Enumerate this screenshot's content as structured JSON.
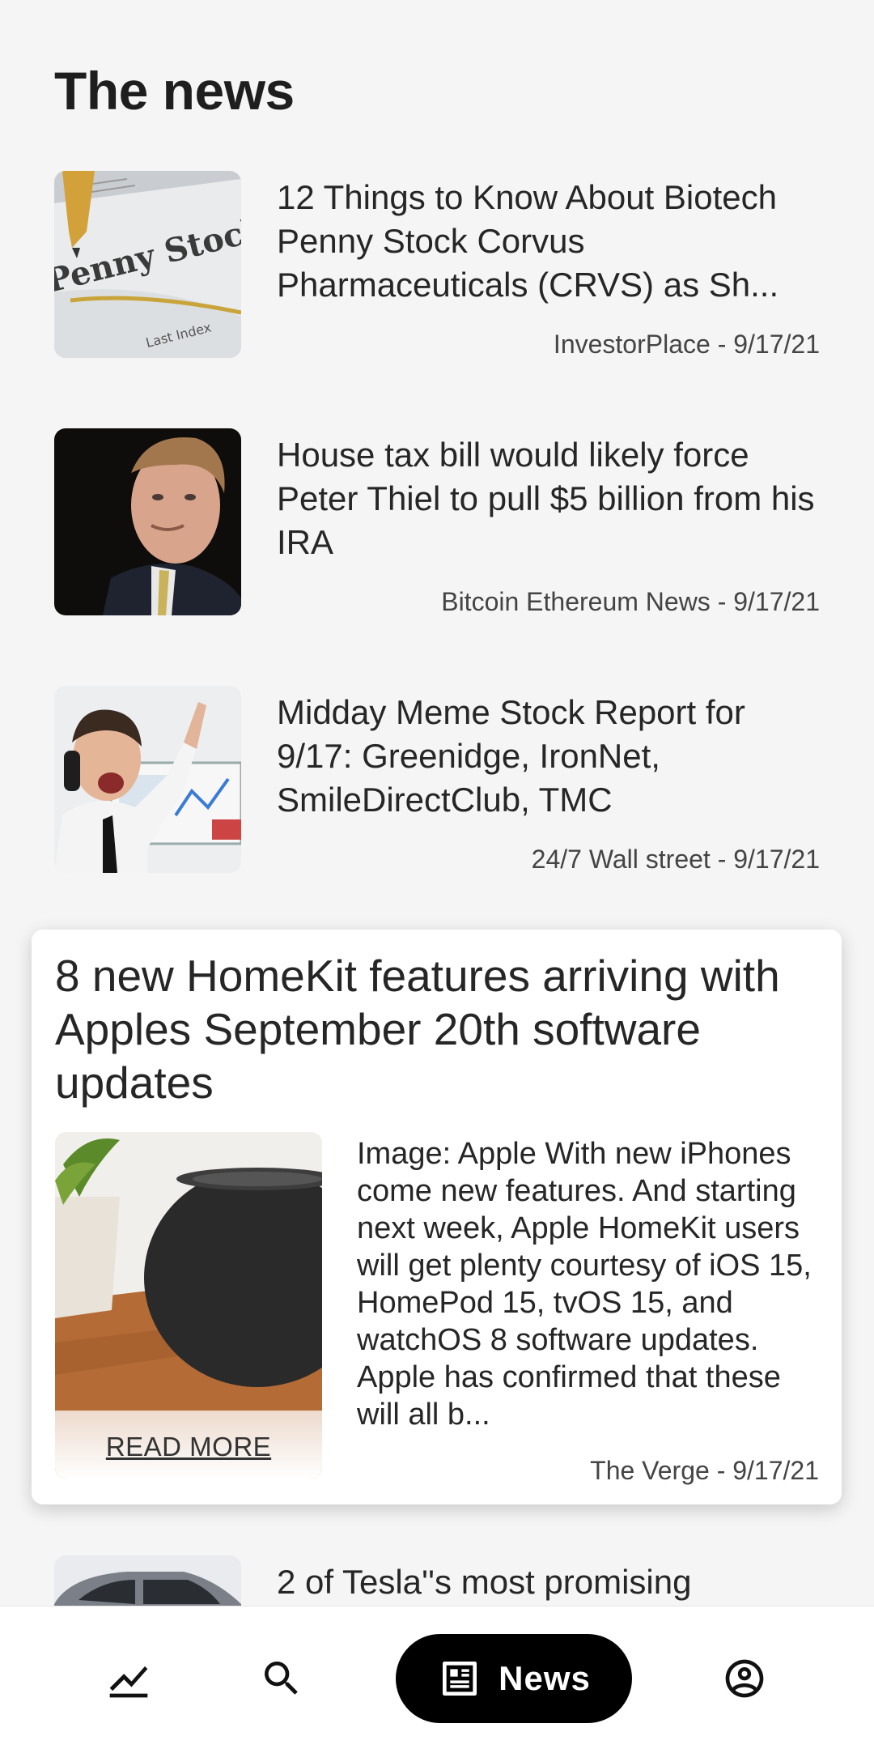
{
  "page": {
    "title": "The news"
  },
  "articles": [
    {
      "title": "12 Things to Know About Biotech Penny Stock Corvus Pharmaceuticals (CRVS) as Sh...",
      "meta": "InvestorPlace - 9/17/21",
      "image": "penny-stocks-newspaper-photo"
    },
    {
      "title": "House tax bill would likely force Peter Thiel to pull $5 billion from his IRA",
      "meta": "Bitcoin Ethereum News - 9/17/21",
      "image": "peter-thiel-portrait-photo"
    },
    {
      "title": "Midday Meme Stock Report for 9/17: Greenidge, IronNet, SmileDirectClub, TMC",
      "meta": "24/7 Wall street - 9/17/21",
      "image": "trader-on-phone-photo"
    }
  ],
  "featured": {
    "title": "8 new HomeKit features arriving with Apples September 20th software updates",
    "summary": "Image: Apple With new iPhones come new features. And starting next week, Apple HomeKit users will get plenty courtesy of iOS 15, HomePod 15, tvOS 15, and watchOS 8 software updates. Apple has confirmed that these will all b...",
    "read_more": "READ MORE",
    "meta": "The Verge - 9/17/21",
    "image": "homepod-mini-photo"
  },
  "partial_article": {
    "title": "2 of Tesla''s most promising",
    "image": "car-photo"
  },
  "nav": {
    "items": [
      {
        "icon": "chart-icon"
      },
      {
        "icon": "search-icon"
      },
      {
        "icon": "newspaper-icon",
        "label": "News",
        "active": true
      },
      {
        "icon": "account-icon"
      }
    ]
  }
}
